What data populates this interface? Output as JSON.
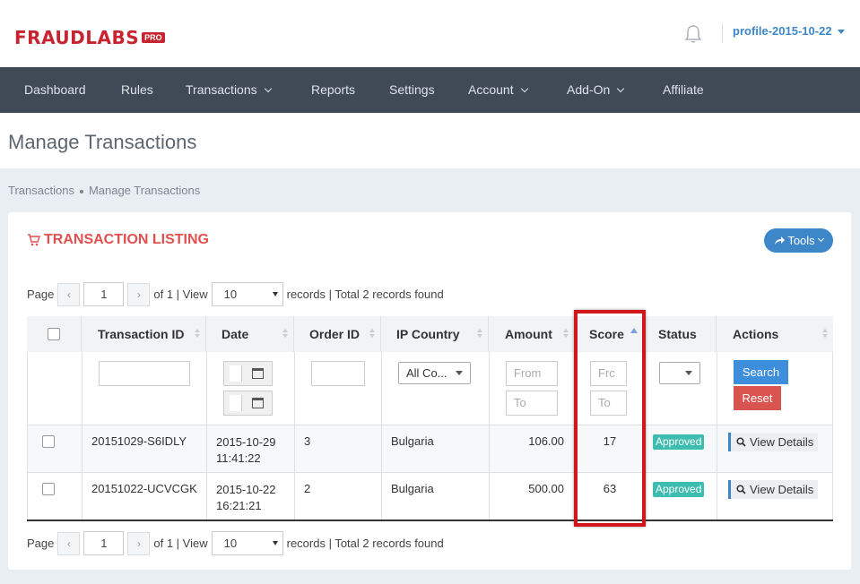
{
  "brand": {
    "name": "FRAUDLABS",
    "badge": "PRO"
  },
  "header": {
    "profile": "profile-2015-10-22"
  },
  "nav": [
    {
      "label": "Dashboard",
      "dropdown": false
    },
    {
      "label": "Rules",
      "dropdown": false
    },
    {
      "label": "Transactions",
      "dropdown": true
    },
    {
      "label": "Reports",
      "dropdown": false
    },
    {
      "label": "Settings",
      "dropdown": false
    },
    {
      "label": "Account",
      "dropdown": true
    },
    {
      "label": "Add-On",
      "dropdown": true
    },
    {
      "label": "Affiliate",
      "dropdown": false
    }
  ],
  "page_title": "Manage Transactions",
  "breadcrumb": [
    "Transactions",
    "Manage Transactions"
  ],
  "panel": {
    "title": "TRANSACTION LISTING",
    "tools": "Tools"
  },
  "pager": {
    "page_label": "Page",
    "page": "1",
    "of_text": "of 1 | View",
    "view": "10",
    "summary": "records | Total 2 records found",
    "prev": "‹",
    "next": "›"
  },
  "table": {
    "columns": [
      "Transaction ID",
      "Date",
      "Order ID",
      "IP Country",
      "Amount",
      "Score",
      "Status",
      "Actions"
    ],
    "filters": {
      "country": "All Co...",
      "amount_from": "From",
      "amount_to": "To",
      "score_from": "Frc",
      "score_to": "To",
      "search": "Search",
      "reset": "Reset"
    },
    "rows": [
      {
        "id": "20151029-S6IDLY",
        "date": "2015-10-29",
        "time": "11:41:22",
        "order": "3",
        "country": "Bulgaria",
        "amount": "106.00",
        "score": "17",
        "status": "Approved",
        "action": "View Details"
      },
      {
        "id": "20151022-UCVCGK",
        "date": "2015-10-22",
        "time": "16:21:21",
        "order": "2",
        "country": "Bulgaria",
        "amount": "500.00",
        "score": "63",
        "status": "Approved",
        "action": "View Details"
      }
    ]
  },
  "colors": {
    "brand": "#c8242f",
    "nav_bg": "#3f4a56",
    "accent": "#3d87c8",
    "highlight": "#d0181c",
    "approved": "#3dbcb0"
  }
}
